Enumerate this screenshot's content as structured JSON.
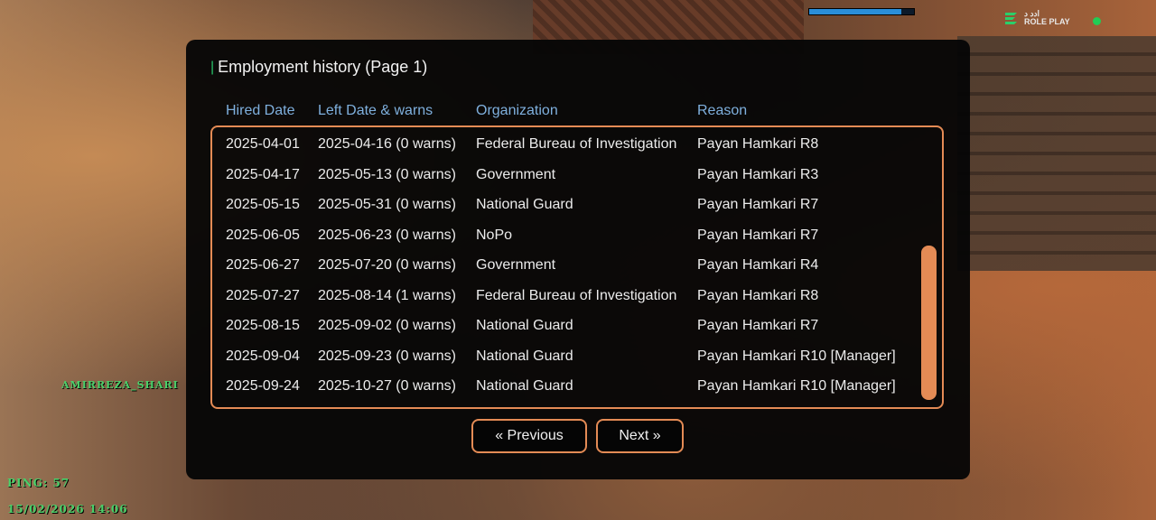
{
  "hud": {
    "logo_line1": "ادد د",
    "logo_line2": "ROLE PLAY",
    "health_fraction": 0.88,
    "name_tag": "AMIRREZA_SHARI",
    "ping": "PING: 57",
    "datetime": "15/02/2026 14:06",
    "status_color": "#22cc55"
  },
  "panel": {
    "title": "Employment history (Page 1)",
    "columns": [
      "Hired Date",
      "Left Date & warns",
      "Organization",
      "Reason"
    ],
    "rows": [
      [
        "2025-04-01",
        "2025-04-16 (0 warns)",
        "Federal Bureau of Investigation",
        "Payan Hamkari R8"
      ],
      [
        "2025-04-17",
        "2025-05-13 (0 warns)",
        "Government",
        "Payan Hamkari R3"
      ],
      [
        "2025-05-15",
        "2025-05-31 (0 warns)",
        "National Guard",
        "Payan Hamkari R7"
      ],
      [
        "2025-06-05",
        "2025-06-23 (0 warns)",
        "NoPo",
        "Payan Hamkari R7"
      ],
      [
        "2025-06-27",
        "2025-07-20 (0 warns)",
        "Government",
        "Payan Hamkari R4"
      ],
      [
        "2025-07-27",
        "2025-08-14 (1 warns)",
        "Federal Bureau of Investigation",
        "Payan Hamkari R8"
      ],
      [
        "2025-08-15",
        "2025-09-02 (0 warns)",
        "National Guard",
        "Payan Hamkari R7"
      ],
      [
        "2025-09-04",
        "2025-09-23 (0 warns)",
        "National Guard",
        "Payan Hamkari R10 [Manager]"
      ],
      [
        "2025-09-24",
        "2025-10-27 (0 warns)",
        "National Guard",
        "Payan Hamkari R10 [Manager]"
      ]
    ],
    "prev_label": "« Previous",
    "next_label": "Next »",
    "accent_color": "#e48b55",
    "header_color": "#7fb0de"
  }
}
